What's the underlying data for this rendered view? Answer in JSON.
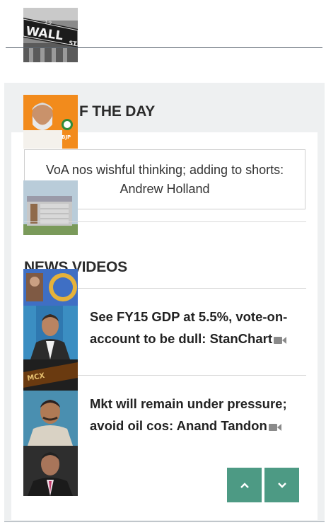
{
  "top_image": {
    "sign_text": "WALL",
    "sign_suffix": "ST",
    "sign_number": "1-9"
  },
  "quote_section": {
    "title_visible": "F THE DAY",
    "quote": "VoA nos wishful thinking; adding to shorts: Andrew Holland"
  },
  "thumbs": {
    "bjp_label": "BJP",
    "mcx_label": "MCX"
  },
  "videos_section": {
    "title": "NEWS VIDEOS",
    "items": [
      {
        "title": "See FY15 GDP at 5.5%, vote-on-account to be dull: StanChart"
      },
      {
        "title": "Mkt will remain under pressure; avoid oil cos: Anand Tandon"
      }
    ]
  },
  "pager": {
    "up_icon": "chevron-up-icon",
    "down_icon": "chevron-down-icon"
  },
  "colors": {
    "accent": "#4d9a84",
    "panel_bg": "#eef0f1",
    "text": "#222222"
  }
}
